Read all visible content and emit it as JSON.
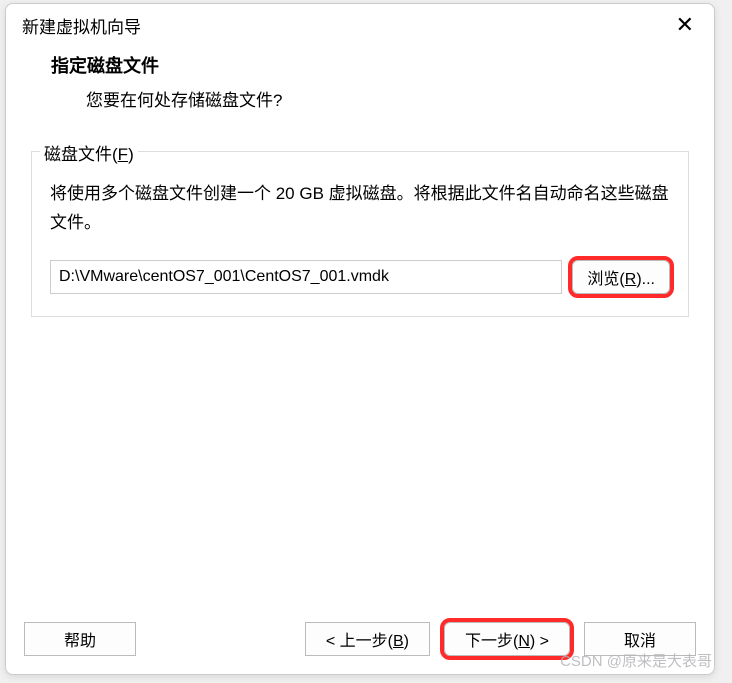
{
  "dialog": {
    "title": "新建虚拟机向导",
    "header": {
      "title": "指定磁盘文件",
      "subtitle": "您要在何处存储磁盘文件?"
    }
  },
  "disk_file": {
    "legend_prefix": "磁盘文件(",
    "legend_hotkey": "F",
    "legend_suffix": ")",
    "description": "将使用多个磁盘文件创建一个 20 GB 虚拟磁盘。将根据此文件名自动命名这些磁盘文件。",
    "path": "D:\\VMware\\centOS7_001\\CentOS7_001.vmdk",
    "browse_prefix": "浏览(",
    "browse_hotkey": "R",
    "browse_suffix": ")..."
  },
  "buttons": {
    "help": "帮助",
    "back_prefix": "< 上一步(",
    "back_hotkey": "B",
    "back_suffix": ")",
    "next_prefix": "下一步(",
    "next_hotkey": "N",
    "next_suffix": ") >",
    "cancel": "取消"
  },
  "watermark": "CSDN @原来是大表哥"
}
